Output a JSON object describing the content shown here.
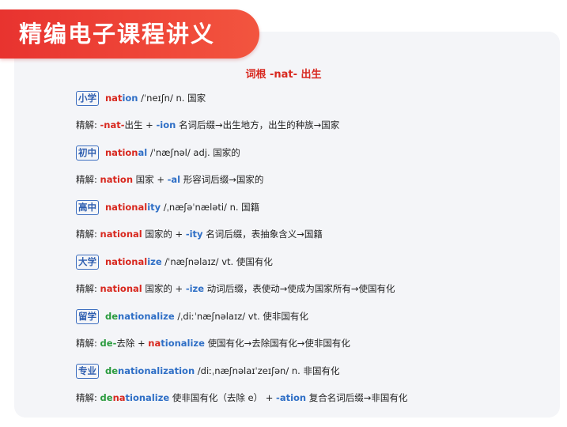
{
  "banner_title": "精编电子课程讲义",
  "subtitle": "词根  -nat-  出生",
  "rows": [
    {
      "badge": "小学",
      "w1": "nat",
      "w2": "ion",
      "w3": "",
      "rest": " /ˈneɪʃn/ n. 国家"
    },
    {
      "label": "精解:",
      "p1": "-nat-",
      "t1": "出生  +  ",
      "p2": "-ion",
      "t2": " 名词后缀→出生地方，出生的种族→国家"
    },
    {
      "badge": "初中",
      "w1": "nation",
      "w2": "al",
      "w3": "",
      "rest": " /ˈnæʃnəl/ adj. 国家的"
    },
    {
      "label": "精解:",
      "p1": "nation",
      "t1": " 国家  +  ",
      "p2": "-al",
      "t2": " 形容词后缀→国家的"
    },
    {
      "badge": "高中",
      "w1": "national",
      "w2": "ity",
      "w3": "",
      "rest": " /ˌnæʃəˈnæləti/ n. 国籍"
    },
    {
      "label": "精解:",
      "p1": "national",
      "t1": " 国家的  +  ",
      "p2": "-ity",
      "t2": " 名词后缀，表抽象含义→国籍"
    },
    {
      "badge": "大学",
      "w1": "national",
      "w2": "ize",
      "w3": "",
      "rest": " /ˈnæʃnəlaɪz/ vt. 使国有化"
    },
    {
      "label": "精解:",
      "p1": "national",
      "t1": " 国家的  +  ",
      "p2": "-ize",
      "t2": " 动词后缀，表使动→使成为国家所有→使国有化"
    },
    {
      "badge": "留学",
      "w0": "de",
      "w1": "nationalize",
      "rest": " /ˌdiːˈnæʃnəlaɪz/ vt. 使非国有化"
    },
    {
      "label": "精解:",
      "g1": "de-",
      "t0": "去除  +  ",
      "r1": "na",
      "b1": "tionalize",
      "t1": " 使国有化→去除国有化→使非国有化"
    },
    {
      "badge": "专业",
      "w0": "de",
      "w1": "nationaliz",
      "w2": "ation",
      "rest": " /diːˌnæʃnəlaɪˈzeɪʃən/ n. 非国有化"
    },
    {
      "label": "精解:",
      "g1": "de",
      "r1": "na",
      "b1": "tionalize",
      "t1": " 使非国有化（去除 e）  +  ",
      "p2": "-ation",
      "t2": " 复合名词后缀→非国有化"
    }
  ]
}
